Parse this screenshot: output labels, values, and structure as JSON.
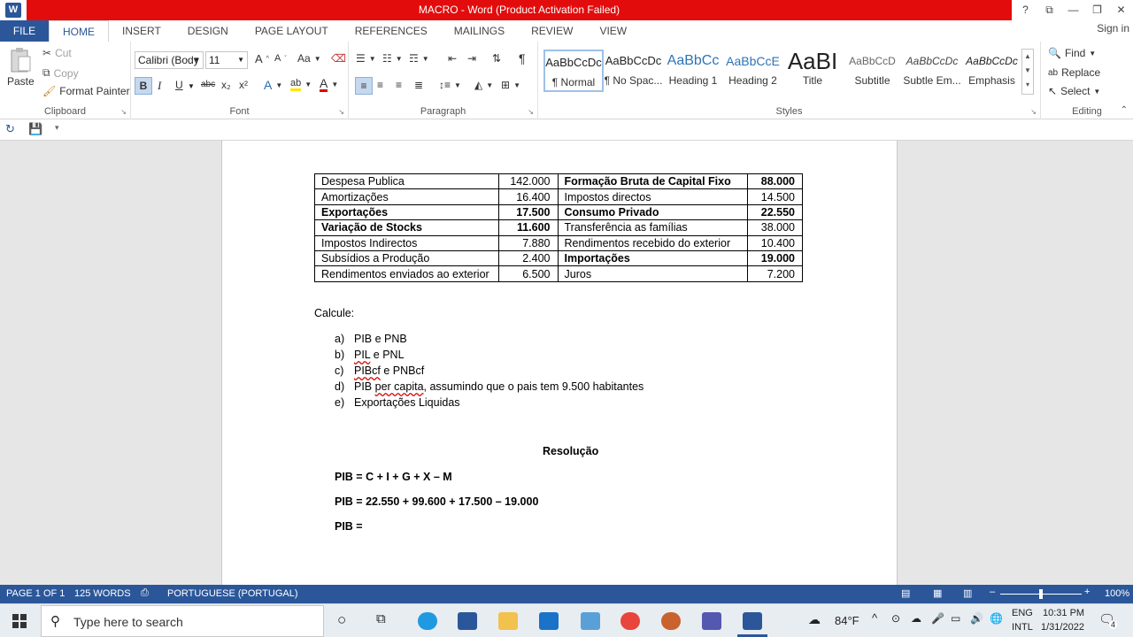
{
  "titlebar": {
    "text": "MACRO -  Word (Product Activation Failed)",
    "word_icon": "W",
    "buttons": {
      "help": "?",
      "restore_ribbon": "⧉",
      "minimize": "—",
      "maximize": "❐",
      "close": "✕"
    }
  },
  "tabs": {
    "file": "FILE",
    "items": [
      "HOME",
      "INSERT",
      "DESIGN",
      "PAGE LAYOUT",
      "REFERENCES",
      "MAILINGS",
      "REVIEW",
      "VIEW"
    ],
    "active": "HOME",
    "signin": "Sign in"
  },
  "clipboard": {
    "paste": "Paste",
    "cut": "Cut",
    "copy": "Copy",
    "format_painter": "Format Painter",
    "label": "Clipboard"
  },
  "font": {
    "name": "Calibri (Body",
    "size": "11",
    "label": "Font",
    "grow": "A",
    "shrink": "A",
    "case": "Aa",
    "bold": "B",
    "italic": "I",
    "underline": "U",
    "strike": "abc",
    "sub": "x₂",
    "sup": "x²",
    "effects": "A",
    "highlight": "ab",
    "color": "A"
  },
  "paragraph": {
    "label": "Paragraph",
    "pilcrow": "¶"
  },
  "styles": {
    "label": "Styles",
    "items": [
      {
        "preview": "AaBbCcDc",
        "name": "¶ Normal"
      },
      {
        "preview": "AaBbCcDc",
        "name": "¶ No Spac..."
      },
      {
        "preview": "AaBbCc",
        "name": "Heading 1"
      },
      {
        "preview": "AaBbCcE",
        "name": "Heading 2"
      },
      {
        "preview": "AaBI",
        "name": "Title"
      },
      {
        "preview": "AaBbCcD",
        "name": "Subtitle"
      },
      {
        "preview": "AaBbCcDc",
        "name": "Subtle Em..."
      },
      {
        "preview": "AaBbCcDc",
        "name": "Emphasis"
      }
    ]
  },
  "editing": {
    "label": "Editing",
    "find": "Find",
    "replace": "Replace",
    "select": "Select"
  },
  "document": {
    "table": [
      [
        {
          "t": "Despesa Publica",
          "b": false
        },
        {
          "t": "142.000",
          "b": false
        },
        {
          "t": "Formação Bruta de Capital Fixo",
          "b": true
        },
        {
          "t": "88.000",
          "b": true
        }
      ],
      [
        {
          "t": "Amortizações",
          "b": false
        },
        {
          "t": "16.400",
          "b": false
        },
        {
          "t": "Impostos directos",
          "b": false
        },
        {
          "t": "14.500",
          "b": false
        }
      ],
      [
        {
          "t": "Exportações",
          "b": true
        },
        {
          "t": "17.500",
          "b": true
        },
        {
          "t": "Consumo Privado",
          "b": true
        },
        {
          "t": "22.550",
          "b": true
        }
      ],
      [
        {
          "t": "Variação de Stocks",
          "b": true
        },
        {
          "t": "11.600",
          "b": true
        },
        {
          "t": "Transferência as famílias",
          "b": false
        },
        {
          "t": "38.000",
          "b": false
        }
      ],
      [
        {
          "t": "Impostos Indirectos",
          "b": false
        },
        {
          "t": "7.880",
          "b": false
        },
        {
          "t": "Rendimentos recebido do exterior",
          "b": false
        },
        {
          "t": "10.400",
          "b": false
        }
      ],
      [
        {
          "t": "Subsídios a Produção",
          "b": false
        },
        {
          "t": "2.400",
          "b": false
        },
        {
          "t": "Importações",
          "b": true
        },
        {
          "t": "19.000",
          "b": true
        }
      ],
      [
        {
          "t": "Rendimentos enviados ao exterior",
          "b": false
        },
        {
          "t": "6.500",
          "b": false
        },
        {
          "t": "Juros",
          "b": false
        },
        {
          "t": "7.200",
          "b": false
        }
      ]
    ],
    "calcule": "Calcule:",
    "list": [
      {
        "m": "a)",
        "pre": "PIB e PNB",
        "sq": "",
        "post": ""
      },
      {
        "m": "b)",
        "pre": "",
        "sq": "PIL",
        "post": " e PNL"
      },
      {
        "m": "c)",
        "pre": "",
        "sq": "PIBcf",
        "post": " e PNBcf"
      },
      {
        "m": "d)",
        "pre": "PIB ",
        "sq": "per capita",
        "post": ", assumindo que o pais tem 9.500 habitantes"
      },
      {
        "m": "e)",
        "pre": "Exportações Liquidas",
        "sq": "",
        "post": ""
      }
    ],
    "resolucao": "Resolução",
    "eq1": "PIB = C + I + G + X – M",
    "eq2": "PIB = 22.550 + 99.600 + 17.500 – 19.000",
    "eq3": "PIB ="
  },
  "status": {
    "page": "PAGE 1 OF 1",
    "words": "125 WORDS",
    "language": "PORTUGUESE (PORTUGAL)",
    "zoom": "100%",
    "zoom_level": 1.0
  },
  "taskbar": {
    "search": "Type here to search",
    "weather": "84°F",
    "lang1": "ENG",
    "lang2": "INTL",
    "time": "10:31 PM",
    "date": "1/31/2022",
    "notif": "4"
  }
}
